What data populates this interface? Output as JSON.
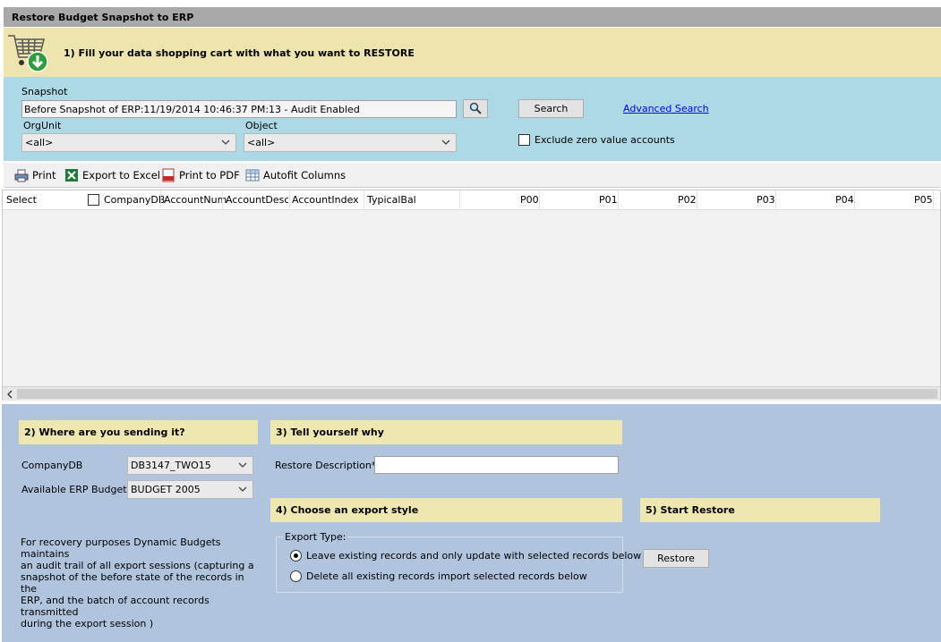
{
  "window": {
    "title": "Restore Budget Snapshot to ERP"
  },
  "step1": {
    "label": "1) Fill your data shopping cart with what you want to RESTORE",
    "icon": "shopping-cart-download-icon"
  },
  "filters": {
    "snapshot_label": "Snapshot",
    "snapshot_value": "Before Snapshot of ERP:11/19/2014 10:46:37 PM:13 - Audit Enabled",
    "orgunit_label": "OrgUnit",
    "orgunit_value": "<all>",
    "object_label": "Object",
    "object_value": "<all>",
    "search_button": "Search",
    "advanced_search": "Advanced Search",
    "exclude_zero": "Exclude zero value accounts",
    "exclude_zero_checked": false
  },
  "toolbar": {
    "print": "Print",
    "export_excel": "Export to Excel",
    "print_pdf": "Print to PDF",
    "autofit": "Autofit Columns"
  },
  "grid": {
    "columns": [
      "Select",
      "CompanyDB",
      "AccountNum",
      "AccountDescr",
      "AccountIndex",
      "TypicalBal",
      "P00",
      "P01",
      "P02",
      "P03",
      "P04",
      "P05"
    ],
    "rows": []
  },
  "step2": {
    "header": "2) Where are you sending it?",
    "companydb_label": "CompanyDB",
    "companydb_value": "DB3147_TWO15",
    "budgets_label": "Available ERP Budgets",
    "budgets_value": "BUDGET 2005",
    "note_lines": [
      "For recovery purposes Dynamic Budgets maintains",
      "an audit trail of all export sessions (capturing a",
      "snapshot  of the before state of the records in the",
      "ERP, and the batch of account records transmitted",
      "during the export session )"
    ]
  },
  "step3": {
    "header": "3) Tell yourself why",
    "desc_label": "Restore Description*",
    "desc_value": ""
  },
  "step4": {
    "header": "4) Choose an export style",
    "group_label": "Export Type:",
    "option1": "Leave existing records and only update with selected records below",
    "option2": "Delete all existing records  import selected records below",
    "selected": 1
  },
  "step5": {
    "header": "5) Start Restore",
    "restore_button": "Restore"
  },
  "colors": {
    "title_bar": "#a9a9a9",
    "section_yellow": "#ede5ad",
    "filter_blue": "#add8e6",
    "bottom_blue": "#b0c4de"
  }
}
